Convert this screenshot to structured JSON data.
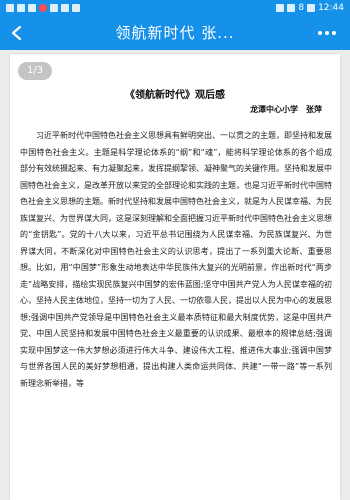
{
  "status_bar": {
    "time": "12:44",
    "battery": "8"
  },
  "app_bar": {
    "title": "领航新时代 张..."
  },
  "viewer": {
    "page_indicator": "1/3"
  },
  "document": {
    "title": "《领航新时代》观后感",
    "author": "龙潭中心小学　张萍",
    "body": "习近平新时代中国特色社会主义思想具有鲜明突出、一以贯之的主题，即坚持和发展中国特色社会主义。主题是科学理论体系的“纲”和“魂”，能将科学理论体系的各个组成部分有效统摄起来、有力凝聚起来，发挥提纲挈领、凝神聚气的关键作用。坚持和发展中国特色社会主义，是改革开放以来党的全部理论和实践的主题，也是习近平新时代中国特色社会主义思想的主题。新时代坚持和发展中国特色社会主义，就是为人民谋幸福、为民族谋复兴、为世界谋大同，这是深刻理解和全面把握习近平新时代中国特色社会主义思想的“金钥匙”。党的十八大以来，习近平总书记围绕为人民谋幸福、为民族谋复兴、为世界谋大同，不断深化对中国特色社会主义的认识思考，提出了一系列重大论断、重要思想。比如，用“中国梦”形象生动地表达中华民族伟大复兴的光明前景，作出新时代“两步走”战略安排，描绘实现民族复兴中国梦的宏伟蓝图;坚守中国共产党人为人民谋幸福的初心，坚持人民主体地位，坚持一切为了人民、一切依靠人民，提出以人民为中心的发展思想;强调中国共产党领导是中国特色社会主义最本质特征和最大制度优势，这是中国共产党、中国人民坚持和发展中国特色社会主义最重要的认识成果、最根本的规律总结;强调实现中国梦这一伟大梦想必须进行伟大斗争、建设伟大工程、推进伟大事业;强调中国梦与世界各国人民的美好梦想相通，提出构建人类命运共同体、共建“一带一路”等一系列新理念新举措，等"
  }
}
